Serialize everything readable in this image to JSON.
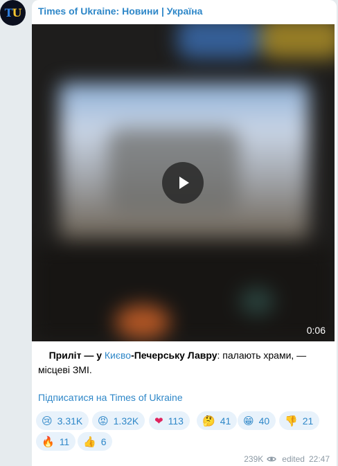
{
  "channel": {
    "name": "Times of Ukraine: Новини | Україна",
    "avatar_letters": {
      "first": "T",
      "second": "U"
    }
  },
  "video": {
    "duration": "0:06",
    "play_icon": "play-icon"
  },
  "post": {
    "text_bold_1": "Приліт — у ",
    "text_link": "Києво",
    "text_bold_2": "-Печерську Лавру",
    "text_rest": ": палають храми, — місцеві ЗМІ.",
    "subscribe_link": "Підписатися на Times of Ukraine"
  },
  "reactions": [
    {
      "emoji": "😢",
      "count": "3.31K"
    },
    {
      "emoji": "😡",
      "count": "1.32K"
    },
    {
      "emoji": "❤",
      "count": "113"
    },
    {
      "emoji": "🤔",
      "count": "41"
    },
    {
      "emoji": "😁",
      "count": "40"
    },
    {
      "emoji": "👎",
      "count": "21"
    },
    {
      "emoji": "🔥",
      "count": "11"
    },
    {
      "emoji": "👍",
      "count": "6"
    }
  ],
  "footer": {
    "views": "239K",
    "views_icon": "eye-icon",
    "edited_label": "edited",
    "time": "22:47"
  },
  "colors": {
    "accent": "#2e87c8",
    "reaction_bg": "#e8f2fb",
    "chat_bg": "#e6ebee"
  }
}
